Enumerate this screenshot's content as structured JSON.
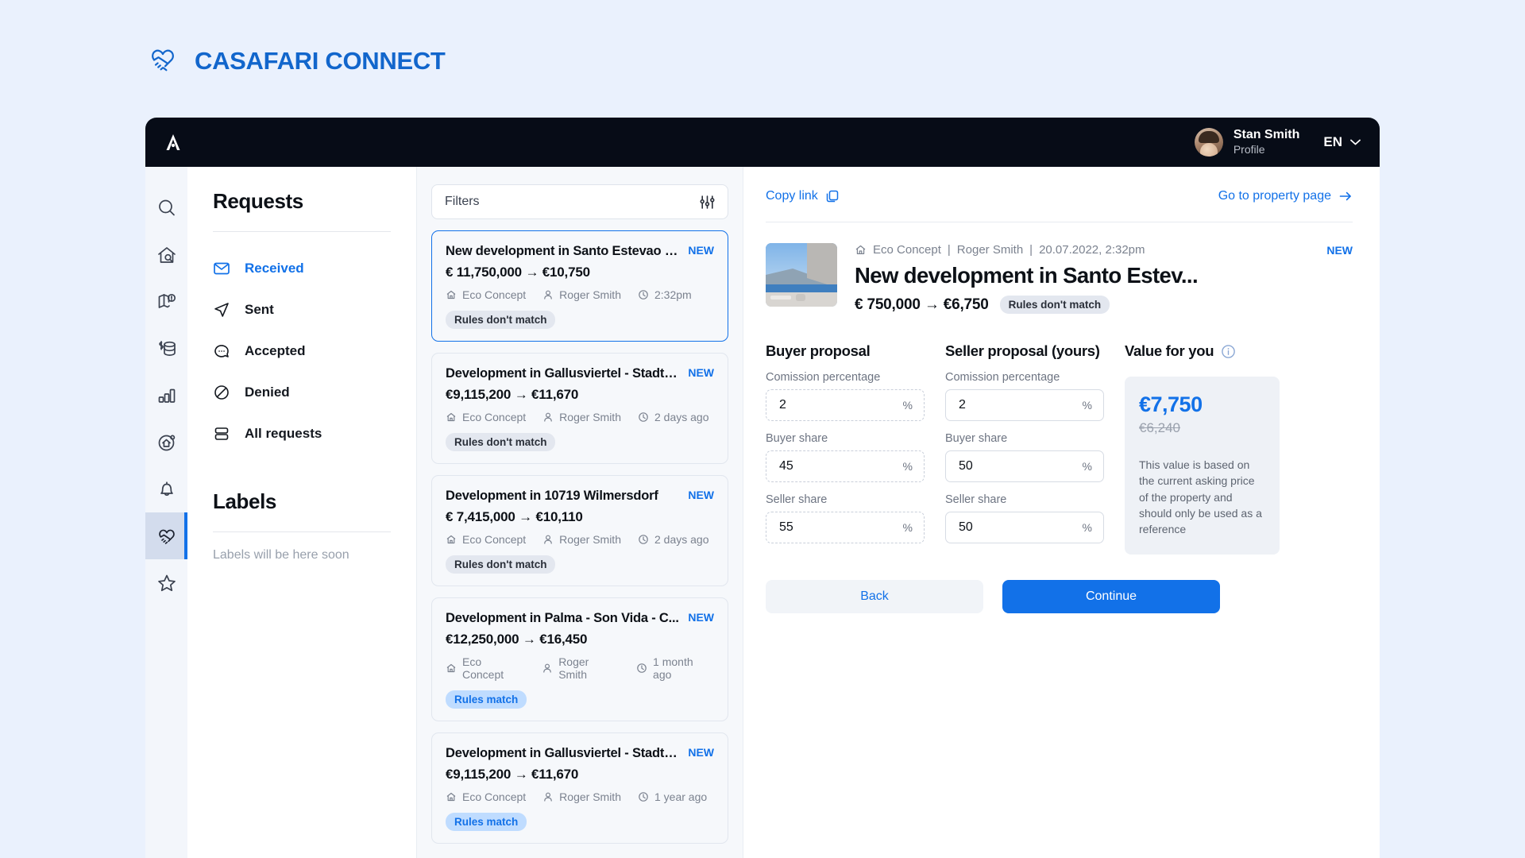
{
  "brand": {
    "name": "CASAFARI CONNECT",
    "logo_icon": "handshake-heart-logo",
    "color": "#1266cc"
  },
  "topbar": {
    "logo_icon": "casafari-a-monogram",
    "user": {
      "name": "Stan Smith",
      "subtitle": "Profile",
      "avatar_icon": "user-avatar"
    },
    "language": {
      "value": "EN",
      "chevron_icon": "chevron-down-icon"
    }
  },
  "rail": {
    "items": [
      {
        "icon": "search-icon",
        "active": false
      },
      {
        "icon": "house-search-icon",
        "active": false
      },
      {
        "icon": "map-alert-icon",
        "active": false
      },
      {
        "icon": "money-stack-icon",
        "active": false
      },
      {
        "icon": "bar-chart-icon",
        "active": false
      },
      {
        "icon": "home-circle-icon",
        "active": false
      },
      {
        "icon": "bell-icon",
        "active": false
      },
      {
        "icon": "handshake-icon",
        "active": true
      },
      {
        "icon": "star-icon",
        "active": false
      }
    ]
  },
  "nav": {
    "title": "Requests",
    "items": [
      {
        "label": "Received",
        "icon": "envelope-icon",
        "active": true
      },
      {
        "label": "Sent",
        "icon": "paper-plane-icon",
        "active": false
      },
      {
        "label": "Accepted",
        "icon": "chat-bubble-icon",
        "active": false
      },
      {
        "label": "Denied",
        "icon": "no-entry-icon",
        "active": false
      },
      {
        "label": "All requests",
        "icon": "stacked-rows-icon",
        "active": false
      }
    ],
    "labels_title": "Labels",
    "labels_empty": "Labels will be here soon"
  },
  "list": {
    "filters_label": "Filters",
    "filters_icon": "sliders-icon",
    "cards": [
      {
        "title": "New development in Santo Estevao E...",
        "badge": "NEW",
        "price_from": "€ 11,750,000",
        "price_to": "€10,750",
        "agency": "Eco Concept",
        "agent": "Roger Smith",
        "time": "2:32pm",
        "rules": "Rules don't match",
        "rules_match": false,
        "selected": true
      },
      {
        "title": "Development in Gallusviertel - Stadtteil",
        "badge": "NEW",
        "price_from": "€9,115,200",
        "price_to": "€11,670",
        "agency": "Eco Concept",
        "agent": "Roger Smith",
        "time": "2 days ago",
        "rules": "Rules don't match",
        "rules_match": false,
        "selected": false
      },
      {
        "title": "Development in 10719 Wilmersdorf",
        "badge": "NEW",
        "price_from": "€ 7,415,000",
        "price_to": "€10,110",
        "agency": "Eco Concept",
        "agent": "Roger Smith",
        "time": "2 days ago",
        "rules": "Rules don't match",
        "rules_match": false,
        "selected": false
      },
      {
        "title": "Development in Palma - Son Vida - C...",
        "badge": "NEW",
        "price_from": "€12,250,000",
        "price_to": "€16,450",
        "agency": "Eco Concept",
        "agent": "Roger Smith",
        "time": "1 month ago",
        "rules": "Rules match",
        "rules_match": true,
        "selected": false
      },
      {
        "title": "Development in Gallusviertel - Stadtteil",
        "badge": "NEW",
        "price_from": "€9,115,200",
        "price_to": "€11,670",
        "agency": "Eco Concept",
        "agent": "Roger Smith",
        "time": "1 year ago",
        "rules": "Rules match",
        "rules_match": true,
        "selected": false
      }
    ]
  },
  "detail": {
    "copy_link": "Copy link",
    "copy_link_icon": "copy-icon",
    "go_to_property": "Go to property page",
    "go_to_property_icon": "arrow-right-icon",
    "property": {
      "agency": "Eco Concept",
      "agent": "Roger Smith",
      "datetime": "20.07.2022, 2:32pm",
      "badge": "NEW",
      "title": "New development in Santo Estev...",
      "price_from": "€ 750,000",
      "price_to": "€6,750",
      "rules": "Rules don't match",
      "thumbnail_icon": "property-photo"
    },
    "buyer": {
      "heading": "Buyer proposal",
      "fields": [
        {
          "label": "Comission percentage",
          "value": "2",
          "unit": "%"
        },
        {
          "label": "Buyer share",
          "value": "45",
          "unit": "%"
        },
        {
          "label": "Seller share",
          "value": "55",
          "unit": "%"
        }
      ]
    },
    "seller": {
      "heading": "Seller proposal (yours)",
      "fields": [
        {
          "label": "Comission percentage",
          "value": "2",
          "unit": "%"
        },
        {
          "label": "Buyer share",
          "value": "50",
          "unit": "%"
        },
        {
          "label": "Seller share",
          "value": "50",
          "unit": "%"
        }
      ]
    },
    "value": {
      "heading": "Value for you",
      "info_icon": "info-icon",
      "amount": "€7,750",
      "previous_amount": "€6,240",
      "note": "This value is based on the current asking price of the property and should only be used as a reference"
    },
    "actions": {
      "back": "Back",
      "continue": "Continue"
    }
  },
  "colors": {
    "accent": "#1271e8",
    "dark": "#070c17",
    "page_bg": "#eaf1fd",
    "chip_match": "#bfdcff"
  }
}
